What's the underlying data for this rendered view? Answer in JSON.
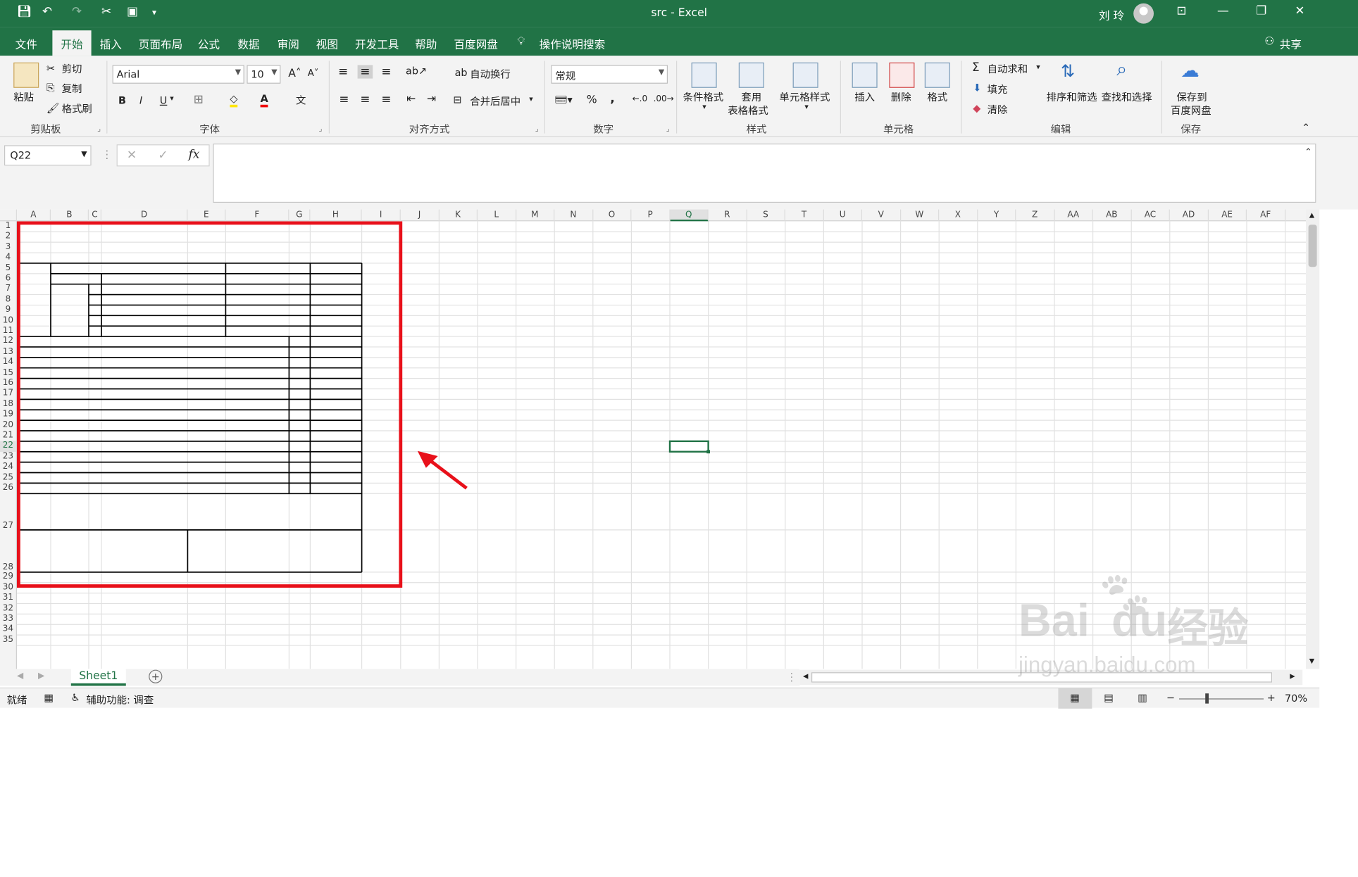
{
  "titlebar": {
    "title": "src  -  Excel",
    "user": "刘 玲",
    "minimize": "—",
    "restore": "❐",
    "close": "✕",
    "ribbon_display": "⊡"
  },
  "tabs": {
    "file": "文件",
    "home": "开始",
    "insert": "插入",
    "layout": "页面布局",
    "formulas": "公式",
    "data": "数据",
    "review": "审阅",
    "view": "视图",
    "developer": "开发工具",
    "help": "帮助",
    "baidu": "百度网盘",
    "tell_me": "操作说明搜索",
    "share": "共享"
  },
  "ribbon": {
    "paste": "粘贴",
    "cut": "剪切",
    "copy": "复制",
    "format_painter": "格式刷",
    "clipboard_label": "剪贴板",
    "font_name": "Arial",
    "font_size": "10",
    "bold": "B",
    "italic": "I",
    "underline": "U",
    "font_label": "字体",
    "wrap_text": "自动换行",
    "merge_center": "合并后居中",
    "align_label": "对齐方式",
    "number_format": "常规",
    "percent": "%",
    "comma": ",",
    "number_label": "数字",
    "conditional": "条件格式",
    "table_fmt_1": "套用",
    "table_fmt_2": "表格格式",
    "cell_styles": "单元格样式",
    "styles_label": "样式",
    "insert": "插入",
    "delete": "删除",
    "format": "格式",
    "cells_label": "单元格",
    "autosum": "自动求和",
    "fill": "填充",
    "clear": "清除",
    "sort_filter": "排序和筛选",
    "find_select": "查找和选择",
    "editing_label": "编辑",
    "save_to_1": "保存到",
    "save_to_2": "百度网盘",
    "save_label": "保存"
  },
  "formula_bar": {
    "name_box": "Q22",
    "fx": "fx",
    "cancel": "✕",
    "enter": "✓",
    "content": ""
  },
  "columns": [
    "A",
    "B",
    "C",
    "D",
    "E",
    "F",
    "G",
    "H",
    "I",
    "J",
    "K",
    "L",
    "M",
    "N",
    "O",
    "P",
    "Q",
    "R",
    "S",
    "T",
    "U",
    "V",
    "W",
    "X",
    "Y",
    "Z",
    "AA",
    "AB",
    "AC",
    "AD",
    "AE",
    "AF"
  ],
  "rows": [
    "1",
    "2",
    "3",
    "4",
    "5",
    "6",
    "7",
    "8",
    "9",
    "10",
    "11",
    "12",
    "13",
    "14",
    "15",
    "16",
    "17",
    "18",
    "19",
    "20",
    "21",
    "22",
    "23",
    "24",
    "25",
    "26",
    "27",
    "28",
    "29",
    "30",
    "31",
    "32",
    "33",
    "34",
    "35"
  ],
  "selected_cell": {
    "column": "Q",
    "row": "22"
  },
  "sheet_tabs": [
    {
      "label": "Sheet1",
      "active": true
    }
  ],
  "status": {
    "ready": "就绪",
    "accessibility": "辅助功能: 调查",
    "zoom": "70%",
    "zoom_minus": "−",
    "zoom_plus": "+"
  },
  "annotation": {
    "box_color": "#e8101a",
    "arrow_color": "#e8101a"
  },
  "watermark": {
    "line1": "Bai",
    "line2": "du",
    "line3": "经验",
    "url": "jingyan.baidu.com"
  },
  "colors": {
    "excel_green": "#217346",
    "selection": "#217346"
  }
}
